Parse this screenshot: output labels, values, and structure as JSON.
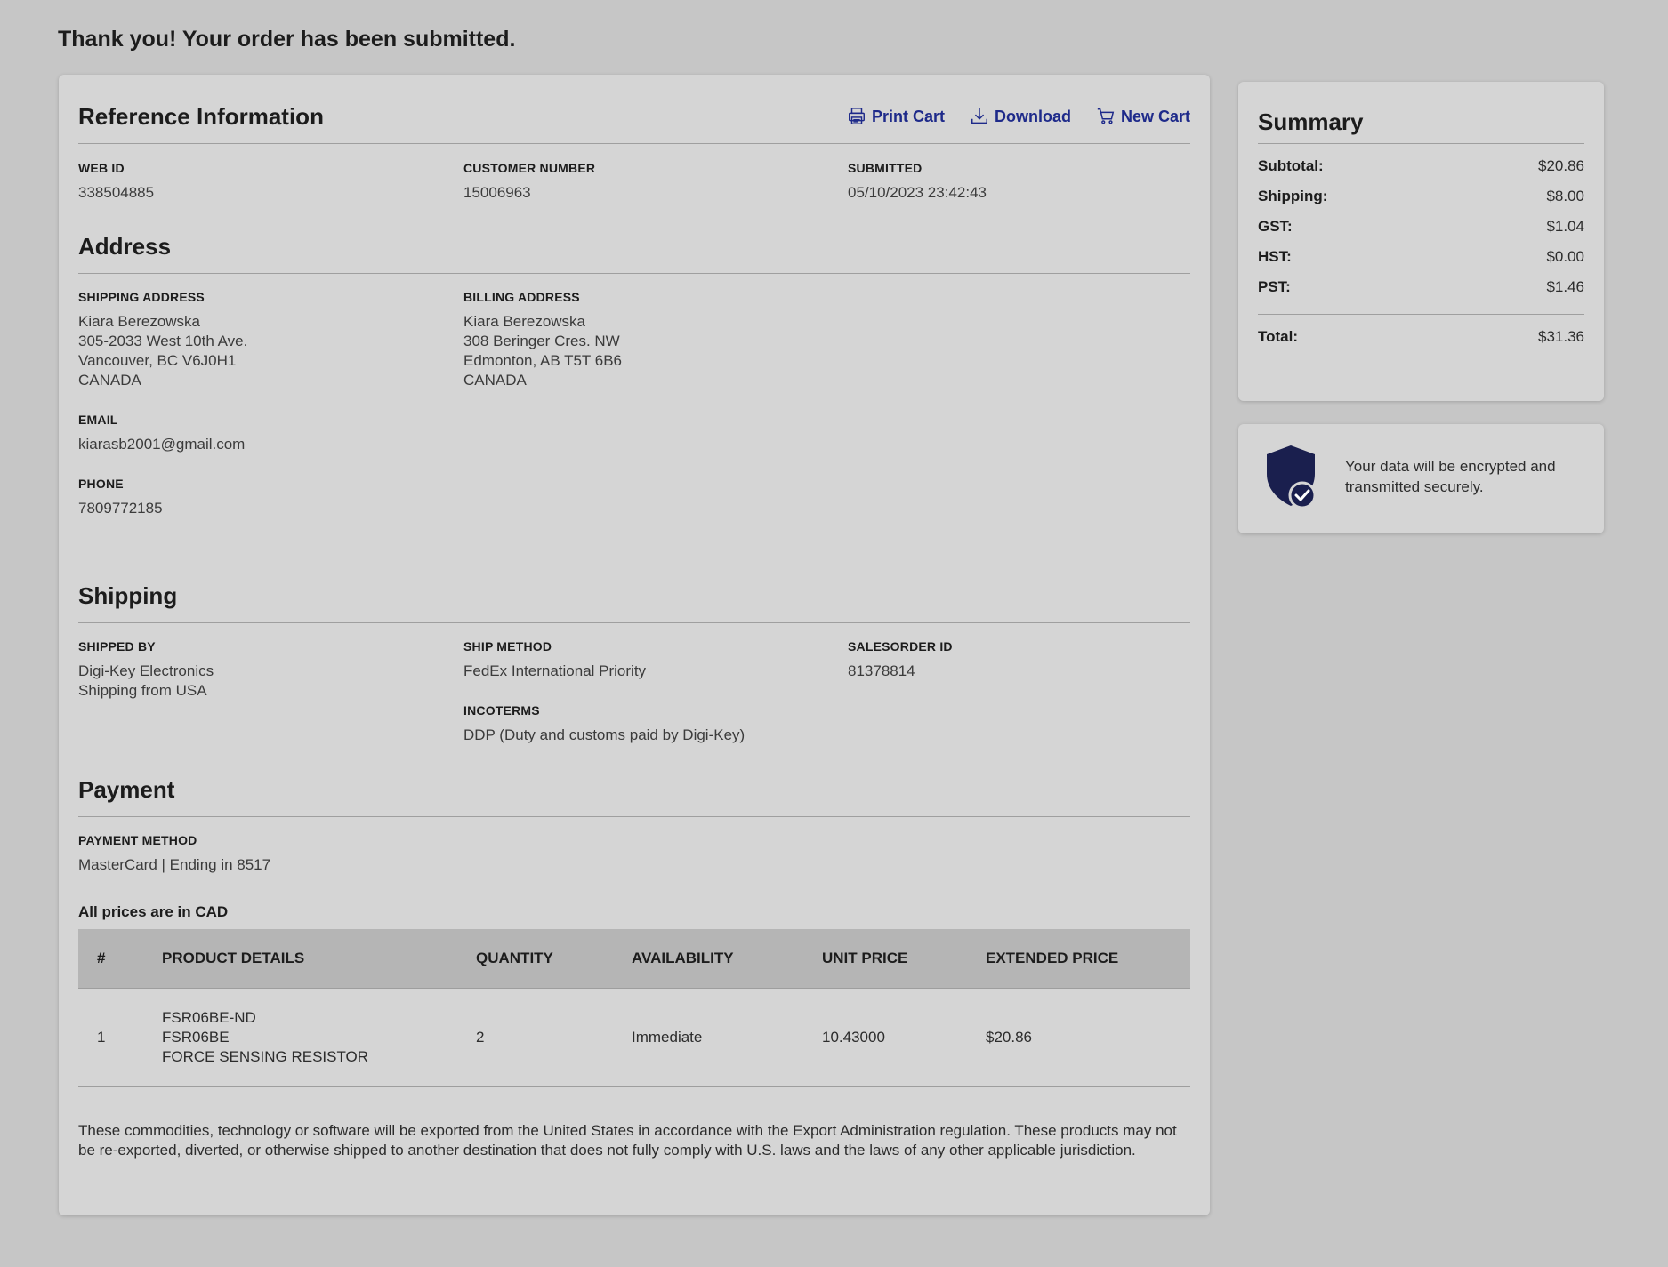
{
  "page_title": "Thank you! Your order has been submitted.",
  "actions": {
    "print": "Print Cart",
    "download": "Download",
    "new_cart": "New Cart"
  },
  "reference": {
    "title": "Reference Information",
    "web_id_label": "WEB ID",
    "web_id": "338504885",
    "customer_number_label": "CUSTOMER NUMBER",
    "customer_number": "15006963",
    "submitted_label": "SUBMITTED",
    "submitted": "05/10/2023 23:42:43"
  },
  "address": {
    "title": "Address",
    "shipping_label": "SHIPPING ADDRESS",
    "shipping": {
      "name": "Kiara Berezowska",
      "line1": "305-2033 West 10th Ave.",
      "line2": "Vancouver, BC V6J0H1",
      "country": "CANADA"
    },
    "billing_label": "BILLING ADDRESS",
    "billing": {
      "name": "Kiara Berezowska",
      "line1": "308 Beringer Cres. NW",
      "line2": "Edmonton, AB T5T 6B6",
      "country": "CANADA"
    },
    "email_label": "EMAIL",
    "email": "kiarasb2001@gmail.com",
    "phone_label": "PHONE",
    "phone": "7809772185"
  },
  "shipping": {
    "title": "Shipping",
    "shipped_by_label": "SHIPPED BY",
    "shipped_by_line1": "Digi-Key Electronics",
    "shipped_by_line2": "Shipping from USA",
    "ship_method_label": "SHIP METHOD",
    "ship_method": "FedEx International Priority",
    "incoterms_label": "INCOTERMS",
    "incoterms": "DDP (Duty and customs paid by Digi-Key)",
    "salesorder_label": "SALESORDER ID",
    "salesorder": "81378814"
  },
  "payment": {
    "title": "Payment",
    "method_label": "PAYMENT METHOD",
    "method": "MasterCard | Ending in 8517"
  },
  "currency_note": "All prices are in CAD",
  "table": {
    "headers": {
      "num": "#",
      "product": "PRODUCT DETAILS",
      "quantity": "QUANTITY",
      "availability": "AVAILABILITY",
      "unit_price": "UNIT PRICE",
      "extended_price": "EXTENDED PRICE"
    },
    "rows": [
      {
        "num": "1",
        "part_number": "FSR06BE-ND",
        "mfr_part": "FSR06BE",
        "description": "FORCE SENSING RESISTOR",
        "quantity": "2",
        "availability": "Immediate",
        "unit_price": "10.43000",
        "extended_price": "$20.86"
      }
    ]
  },
  "disclaimer": "These commodities, technology or software will be exported from the United States in accordance with the Export Administration regulation. These products may not be re-exported, diverted, or otherwise shipped to another destination that does not fully comply with U.S. laws and the laws of any other applicable jurisdiction.",
  "summary": {
    "title": "Summary",
    "subtotal_label": "Subtotal:",
    "subtotal": "$20.86",
    "shipping_label": "Shipping:",
    "shipping": "$8.00",
    "gst_label": "GST:",
    "gst": "$1.04",
    "hst_label": "HST:",
    "hst": "$0.00",
    "pst_label": "PST:",
    "pst": "$1.46",
    "total_label": "Total:",
    "total": "$31.36"
  },
  "security": {
    "icon": "shield-check-icon",
    "text": "Your data will be encrypted and transmitted securely."
  },
  "colors": {
    "link": "#1e2a8a",
    "shield": "#1a1f4e",
    "background": "#c6c6c6",
    "card": "#d5d5d5"
  }
}
